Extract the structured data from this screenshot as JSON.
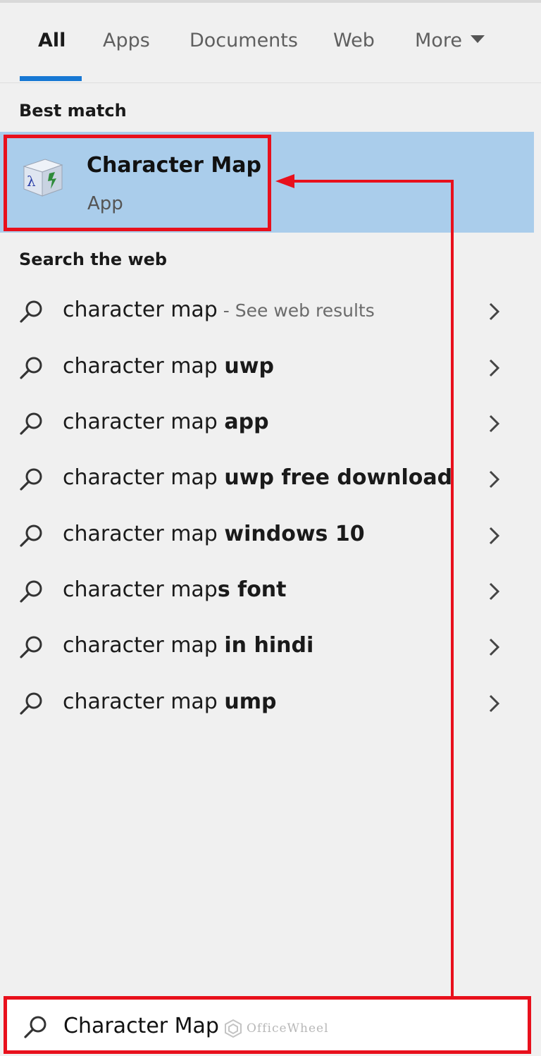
{
  "tabs": [
    {
      "label": "All",
      "active": true
    },
    {
      "label": "Apps",
      "active": false
    },
    {
      "label": "Documents",
      "active": false
    },
    {
      "label": "Web",
      "active": false
    },
    {
      "label": "More",
      "active": false
    }
  ],
  "best_match": {
    "section_title": "Best match",
    "app_name": "Character Map",
    "app_type": "App",
    "icon": "character-map-app-icon"
  },
  "web": {
    "section_title": "Search the web",
    "items": [
      {
        "prefix": "character map",
        "bold": "",
        "hint": " - See web results"
      },
      {
        "prefix": "character map ",
        "bold": "uwp",
        "hint": ""
      },
      {
        "prefix": "character map ",
        "bold": "app",
        "hint": ""
      },
      {
        "prefix": "character map ",
        "bold": "uwp free download",
        "hint": ""
      },
      {
        "prefix": "character map ",
        "bold": "windows 10",
        "hint": ""
      },
      {
        "prefix": "character map",
        "bold": "s font",
        "hint": ""
      },
      {
        "prefix": "character map ",
        "bold": "in hindi",
        "hint": ""
      },
      {
        "prefix": "character map ",
        "bold": "ump",
        "hint": ""
      }
    ]
  },
  "search": {
    "value": "Character Map"
  },
  "watermark": "OfficeWheel",
  "colors": {
    "accent": "#1778d4",
    "highlight": "#aacdeb",
    "annotation": "#e8101c",
    "background": "#f0f0f0"
  }
}
